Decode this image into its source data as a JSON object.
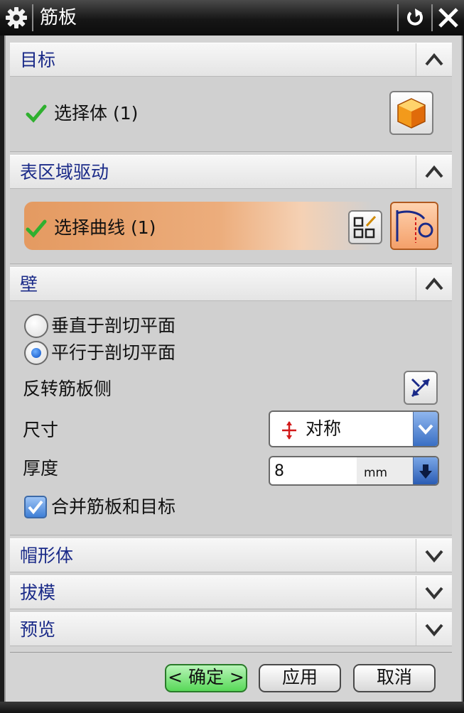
{
  "window": {
    "title": "筋板"
  },
  "sections": {
    "target": {
      "title": "目标",
      "select_label": "选择体 (1)"
    },
    "region_drive": {
      "title": "表区域驱动",
      "select_label": "选择曲线 (1)"
    },
    "wall": {
      "title": "壁",
      "radio_options": [
        "垂直于剖切平面",
        "平行于剖切平面"
      ],
      "selected_option": "平行于剖切平面",
      "flip_label": "反转筋板侧",
      "dimension_label": "尺寸",
      "dimension_value": "对称",
      "thickness_label": "厚度",
      "thickness_value": "8",
      "thickness_unit": "mm",
      "merge_label": "合并筋板和目标",
      "merge_checked": true
    },
    "cap": {
      "title": "帽形体"
    },
    "draft": {
      "title": "拔模"
    },
    "preview": {
      "title": "预览"
    }
  },
  "buttons": {
    "ok": "< 确定 >",
    "apply": "应用",
    "cancel": "取消"
  },
  "colors": {
    "accent_green": "#2fb02f",
    "highlight_orange": "#e49a61",
    "header_text": "#1a2a88"
  }
}
